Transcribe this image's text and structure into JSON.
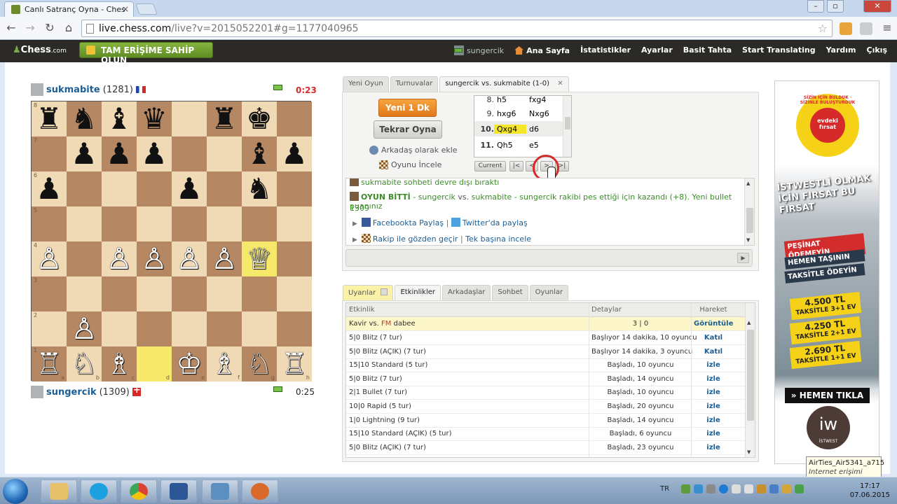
{
  "browser": {
    "tab_title": "Canlı Satranç Oyna - Ches",
    "url_host": "live.chess.com",
    "url_rest": "/live?v=2015052201#g=1177040965",
    "window_buttons": [
      "–",
      "▫",
      "✕"
    ]
  },
  "site": {
    "logo": "Chess",
    "logo_suffix": ".com",
    "premium_button": "TAM ERİŞİME SAHİP OLUN",
    "username": "sungercik",
    "nav": [
      "Ana Sayfa",
      "İstatistikler",
      "Ayarlar",
      "Basit Tahta",
      "Start Translating",
      "Yardım",
      "Çıkış"
    ]
  },
  "top_player": {
    "name": "sukmabite",
    "rating": "(1281)",
    "clock": "0:23",
    "clock_color": "#d22c2c"
  },
  "bottom_player": {
    "name": "sungercik",
    "rating": "(1309)",
    "clock": "0:25",
    "clock_color": "#222222"
  },
  "board": {
    "rows": [
      [
        "♜",
        "♞",
        "♝",
        "♛",
        "",
        "♜",
        "♚",
        ""
      ],
      [
        "",
        "♟",
        "♟",
        "♟",
        "",
        "",
        "♝",
        "♟"
      ],
      [
        "♟",
        "",
        "",
        "",
        "♟",
        "",
        "♞",
        ""
      ],
      [
        "",
        "",
        "",
        "",
        "",
        "",
        "",
        ""
      ],
      [
        "♙",
        "",
        "♙",
        "♙",
        "♙",
        "♙",
        "♕",
        ""
      ],
      [
        "",
        "",
        "",
        "",
        "",
        "",
        "",
        ""
      ],
      [
        "",
        "♙",
        "",
        "",
        "",
        "",
        "",
        ""
      ],
      [
        "♖",
        "♘",
        "♗",
        "",
        "♔",
        "♗",
        "♘",
        "♖"
      ]
    ],
    "ranks": [
      "8",
      "7",
      "6",
      "5",
      "4",
      "3",
      "2",
      "1"
    ],
    "files": [
      "a",
      "b",
      "c",
      "d",
      "e",
      "f",
      "g",
      "h"
    ],
    "light_color": "#f0d9b5",
    "dark_color": "#b58863",
    "highlight_color": "#f6e86a"
  },
  "game_tabs": [
    "Yeni Oyun",
    "Turnuvalar",
    "sungercik vs. sukmabite (1-0)"
  ],
  "game_tab_close": "✕",
  "controls": {
    "new_game": "Yeni 1 Dk",
    "rematch": "Tekrar Oyna",
    "add_friend": "Arkadaş olarak ekle",
    "review": "Oyunu İncele"
  },
  "moves": [
    {
      "no": "8.",
      "white": "h5",
      "black": "fxg4"
    },
    {
      "no": "9.",
      "white": "hxg6",
      "black": "Nxg6"
    },
    {
      "no": "10.",
      "white": "Qxg4",
      "black": "d6"
    },
    {
      "no": "11.",
      "white": "Qh5",
      "black": "e5"
    }
  ],
  "move_nav": {
    "current": "Current",
    "first": "|<",
    "prev": "<",
    "next": ">",
    "last": ">|"
  },
  "chat": {
    "line1": "sukmabite sohbeti devre dışı bıraktı",
    "game_over_label": "OYUN BİTTİ",
    "game_over_a": " - sungercik ",
    "game_over_vs": "vs.",
    "game_over_b": " sukmabite - sungercik rakibi pes ettiği için kazandı (+8). Yeni bullet puanınız",
    "line3": "1309",
    "facebook": "Facebookta Paylaş",
    "twitter": "Twitter'da paylaş",
    "review_opponent": "Rakip ile gözden geçir",
    "review_alone": "Tek başına incele",
    "sep": "|"
  },
  "bottom_tabs": [
    "Uyarılar",
    "Etkinlikler",
    "Arkadaşlar",
    "Sohbet",
    "Oyunlar"
  ],
  "events": {
    "headers": [
      "Etkinlik",
      "Detaylar",
      "Hareket"
    ],
    "featured": {
      "a": "Kavir vs. ",
      "fm": "FM",
      "b": " dabee",
      "detail": "3 | 0",
      "action": "Görüntüle"
    },
    "rows": [
      [
        "5|0 Blitz (7 tur)",
        "Başlıyor 14 dakika, 10 oyuncu",
        "Katıl"
      ],
      [
        "5|0 Blitz (AÇIK) (7 tur)",
        "Başlıyor 14 dakika, 3 oyuncu",
        "Katıl"
      ],
      [
        "15|10 Standard (5 tur)",
        "Başladı, 10 oyuncu",
        "izle"
      ],
      [
        "5|0 Blitz (7 tur)",
        "Başladı, 14 oyuncu",
        "izle"
      ],
      [
        "2|1 Bullet (7 tur)",
        "Başladı, 10 oyuncu",
        "izle"
      ],
      [
        "10|0 Rapid (5 tur)",
        "Başladı, 20 oyuncu",
        "izle"
      ],
      [
        "1|0 Lightning (9 tur)",
        "Başladı, 14 oyuncu",
        "izle"
      ],
      [
        "15|10 Standard (AÇIK) (5 tur)",
        "Başladı, 6 oyuncu",
        "izle"
      ],
      [
        "5|0 Blitz (AÇIK) (7 tur)",
        "Başladı, 23 oyuncu",
        "izle"
      ]
    ]
  },
  "ad": {
    "badge_ring": "SİZİN İÇİN BULDUK · SİZİNLE BULUŞTURDUK",
    "badge_center": "evdeki fırsat",
    "headline": "İSTWESTLİ OLMAK İÇİN FIRSAT BU FIRSAT",
    "s1": "PEŞİNAT ÖDEMEYİN",
    "s2": "HEMEN TAŞININ",
    "s3": "TAKSİTLE ÖDEYİN",
    "p1": "4.500 TL",
    "p1s": "TAKSİTLE 3+1 EV",
    "p2": "4.250 TL",
    "p2s": "TAKSİTLE 2+1 EV",
    "p3": "2.690 TL",
    "p3s": "TAKSİTLE 1+1 EV",
    "cta": "» HEMEN TIKLA",
    "brand_mark": "iw",
    "brand": "İSTWEST"
  },
  "tooltip": {
    "ssid": "AirTies_Air5341_a715",
    "status": "Internet erişimi"
  },
  "taskbar": {
    "lang": "TR",
    "time": "17:17",
    "date": "07.06.2015"
  }
}
